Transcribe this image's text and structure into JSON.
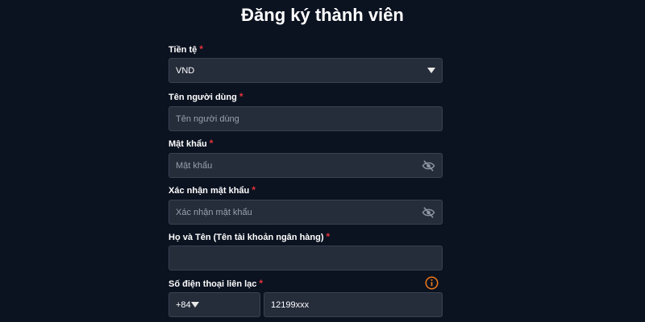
{
  "page": {
    "title": "Đăng ký thành viên"
  },
  "form": {
    "required_mark": "*",
    "currency": {
      "label": "Tiền tệ",
      "value": "VND"
    },
    "username": {
      "label": "Tên người dùng",
      "placeholder": "Tên người dùng"
    },
    "password": {
      "label": "Mật khẩu",
      "placeholder": "Mật khẩu"
    },
    "confirm_password": {
      "label": "Xác nhận mật khẩu",
      "placeholder": "Xác nhận mật khẩu"
    },
    "full_name": {
      "label": "Họ và Tên (Tên tài khoản ngân hàng)",
      "value": ""
    },
    "phone": {
      "label": "Số điện thoại liên lạc",
      "country_code": "+84",
      "placeholder": "12199xxx"
    }
  },
  "colors": {
    "background": "#0b1220",
    "field_bg": "#252c3a",
    "required": "#e5333b",
    "info_accent": "#f07a1a"
  },
  "icons": {
    "currency_dropdown": "chevron-down-icon",
    "password_toggle": "eye-off-icon",
    "confirm_toggle": "eye-off-icon",
    "phone_info": "info-icon",
    "country_dropdown": "chevron-down-icon"
  }
}
